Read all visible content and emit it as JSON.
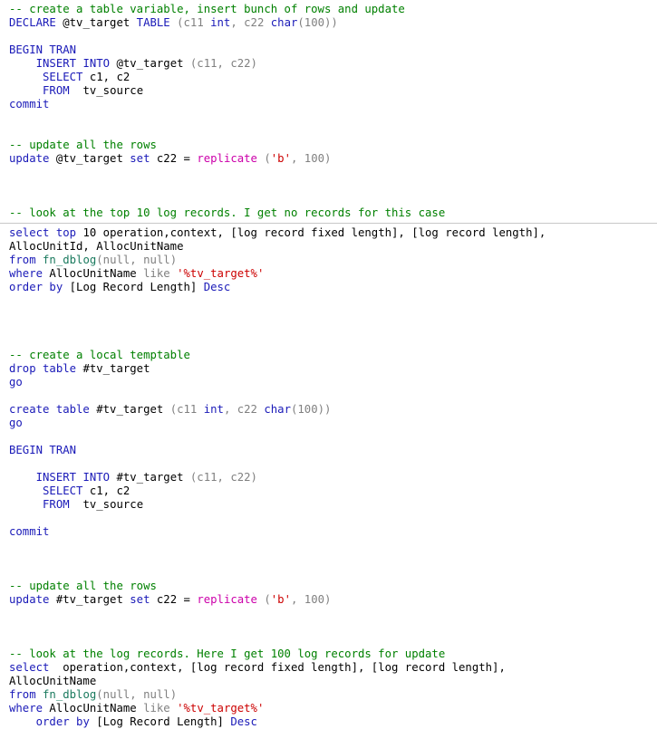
{
  "document": {
    "kind": "sql-code-listing",
    "language": "T-SQL",
    "colors": {
      "background": "#ffffff",
      "comment": "#008000",
      "keyword": "#1a1ab8",
      "string": "#cc0000",
      "function": "#cc00aa",
      "system_function": "#1a7a5e",
      "literal": "#808080",
      "plain_text": "#000000",
      "divider": "#c8c8c8"
    }
  },
  "blocks": [
    {
      "id": "block-1",
      "lines": [
        {
          "indent": 0,
          "tokens": [
            {
              "t": "comment",
              "v": "-- create a table variable, insert bunch of rows and update"
            }
          ]
        },
        {
          "indent": 0,
          "tokens": [
            {
              "t": "keyword",
              "v": "DECLARE"
            },
            {
              "t": "plain",
              "v": " @tv_target "
            },
            {
              "t": "keyword",
              "v": "TABLE"
            },
            {
              "t": "lit",
              "v": " (c11 "
            },
            {
              "t": "keyword",
              "v": "int"
            },
            {
              "t": "lit",
              "v": ", c22 "
            },
            {
              "t": "keyword",
              "v": "char"
            },
            {
              "t": "lit",
              "v": "(100))"
            }
          ]
        },
        {
          "indent": 0,
          "tokens": []
        },
        {
          "indent": 0,
          "tokens": [
            {
              "t": "keyword",
              "v": "BEGIN TRAN"
            }
          ]
        },
        {
          "indent": 0,
          "tokens": [
            {
              "t": "plain",
              "v": "    "
            },
            {
              "t": "keyword",
              "v": "INSERT INTO"
            },
            {
              "t": "plain",
              "v": " @tv_target "
            },
            {
              "t": "lit",
              "v": "(c11, c22)"
            }
          ]
        },
        {
          "indent": 0,
          "tokens": [
            {
              "t": "plain",
              "v": "     "
            },
            {
              "t": "keyword",
              "v": "SELECT"
            },
            {
              "t": "plain",
              "v": " c1, c2"
            }
          ]
        },
        {
          "indent": 0,
          "tokens": [
            {
              "t": "plain",
              "v": "     "
            },
            {
              "t": "keyword",
              "v": "FROM"
            },
            {
              "t": "plain",
              "v": "  tv_source"
            }
          ]
        },
        {
          "indent": 0,
          "tokens": [
            {
              "t": "keyword",
              "v": "commit"
            }
          ]
        },
        {
          "indent": 0,
          "tokens": []
        },
        {
          "indent": 0,
          "tokens": []
        },
        {
          "indent": 0,
          "tokens": [
            {
              "t": "comment",
              "v": "-- update all the rows"
            }
          ]
        },
        {
          "indent": 0,
          "tokens": [
            {
              "t": "keyword",
              "v": "update"
            },
            {
              "t": "plain",
              "v": " @tv_target "
            },
            {
              "t": "keyword",
              "v": "set"
            },
            {
              "t": "plain",
              "v": " c22 "
            },
            {
              "t": "plain",
              "v": "= "
            },
            {
              "t": "func",
              "v": "replicate"
            },
            {
              "t": "lit",
              "v": " ("
            },
            {
              "t": "string",
              "v": "'b'"
            },
            {
              "t": "lit",
              "v": ", 100)"
            }
          ]
        },
        {
          "indent": 0,
          "tokens": []
        },
        {
          "indent": 0,
          "tokens": []
        },
        {
          "indent": 0,
          "tokens": []
        },
        {
          "indent": 0,
          "tokens": [
            {
              "t": "comment",
              "v": "-- look at the top 10 log records. I get no records for this case"
            }
          ]
        }
      ]
    },
    {
      "id": "block-2",
      "divider_before": true,
      "lines": [
        {
          "indent": 0,
          "tokens": [
            {
              "t": "keyword",
              "v": "select top"
            },
            {
              "t": "plain",
              "v": " 10 operation,context, [log record fixed length], [log record length],"
            }
          ]
        },
        {
          "indent": 0,
          "tokens": [
            {
              "t": "plain",
              "v": "AllocUnitId, AllocUnitName"
            }
          ]
        },
        {
          "indent": 0,
          "tokens": [
            {
              "t": "keyword",
              "v": "from"
            },
            {
              "t": "plain",
              "v": " "
            },
            {
              "t": "sysfunc",
              "v": "fn_dblog"
            },
            {
              "t": "lit",
              "v": "(null, null)"
            }
          ]
        },
        {
          "indent": 0,
          "tokens": [
            {
              "t": "keyword",
              "v": "where"
            },
            {
              "t": "plain",
              "v": " AllocUnitName "
            },
            {
              "t": "lit",
              "v": "like"
            },
            {
              "t": "plain",
              "v": " "
            },
            {
              "t": "string",
              "v": "'%tv_target%'"
            }
          ]
        },
        {
          "indent": 0,
          "tokens": [
            {
              "t": "keyword",
              "v": "order by"
            },
            {
              "t": "plain",
              "v": " [Log Record Length] "
            },
            {
              "t": "keyword",
              "v": "Desc"
            }
          ]
        },
        {
          "indent": 0,
          "tokens": []
        },
        {
          "indent": 0,
          "tokens": []
        },
        {
          "indent": 0,
          "tokens": []
        },
        {
          "indent": 0,
          "tokens": []
        },
        {
          "indent": 0,
          "tokens": [
            {
              "t": "comment",
              "v": "-- create a local temptable"
            }
          ]
        },
        {
          "indent": 0,
          "tokens": [
            {
              "t": "keyword",
              "v": "drop table"
            },
            {
              "t": "plain",
              "v": " #tv_target"
            }
          ]
        },
        {
          "indent": 0,
          "tokens": [
            {
              "t": "keyword",
              "v": "go"
            }
          ]
        },
        {
          "indent": 0,
          "tokens": []
        },
        {
          "indent": 0,
          "tokens": [
            {
              "t": "keyword",
              "v": "create table"
            },
            {
              "t": "plain",
              "v": " #tv_target "
            },
            {
              "t": "lit",
              "v": "(c11 "
            },
            {
              "t": "keyword",
              "v": "int"
            },
            {
              "t": "lit",
              "v": ", c22 "
            },
            {
              "t": "keyword",
              "v": "char"
            },
            {
              "t": "lit",
              "v": "(100))"
            }
          ]
        },
        {
          "indent": 0,
          "tokens": [
            {
              "t": "keyword",
              "v": "go"
            }
          ]
        },
        {
          "indent": 0,
          "tokens": []
        },
        {
          "indent": 0,
          "tokens": [
            {
              "t": "keyword",
              "v": "BEGIN TRAN"
            }
          ]
        },
        {
          "indent": 0,
          "tokens": []
        },
        {
          "indent": 0,
          "tokens": [
            {
              "t": "plain",
              "v": "    "
            },
            {
              "t": "keyword",
              "v": "INSERT INTO"
            },
            {
              "t": "plain",
              "v": " #tv_target "
            },
            {
              "t": "lit",
              "v": "(c11, c22)"
            }
          ]
        },
        {
          "indent": 0,
          "tokens": [
            {
              "t": "plain",
              "v": "     "
            },
            {
              "t": "keyword",
              "v": "SELECT"
            },
            {
              "t": "plain",
              "v": " c1, c2"
            }
          ]
        },
        {
          "indent": 0,
          "tokens": [
            {
              "t": "plain",
              "v": "     "
            },
            {
              "t": "keyword",
              "v": "FROM"
            },
            {
              "t": "plain",
              "v": "  tv_source"
            }
          ]
        },
        {
          "indent": 0,
          "tokens": []
        },
        {
          "indent": 0,
          "tokens": [
            {
              "t": "keyword",
              "v": "commit"
            }
          ]
        },
        {
          "indent": 0,
          "tokens": []
        },
        {
          "indent": 0,
          "tokens": []
        },
        {
          "indent": 0,
          "tokens": []
        },
        {
          "indent": 0,
          "tokens": [
            {
              "t": "comment",
              "v": "-- update all the rows"
            }
          ]
        },
        {
          "indent": 0,
          "tokens": [
            {
              "t": "keyword",
              "v": "update"
            },
            {
              "t": "plain",
              "v": " #tv_target "
            },
            {
              "t": "keyword",
              "v": "set"
            },
            {
              "t": "plain",
              "v": " c22 "
            },
            {
              "t": "plain",
              "v": "= "
            },
            {
              "t": "func",
              "v": "replicate"
            },
            {
              "t": "lit",
              "v": " ("
            },
            {
              "t": "string",
              "v": "'b'"
            },
            {
              "t": "lit",
              "v": ", 100)"
            }
          ]
        },
        {
          "indent": 0,
          "tokens": []
        },
        {
          "indent": 0,
          "tokens": []
        },
        {
          "indent": 0,
          "tokens": []
        },
        {
          "indent": 0,
          "tokens": [
            {
              "t": "comment",
              "v": "-- look at the log records. Here I get 100 log records for update"
            }
          ]
        },
        {
          "indent": 0,
          "tokens": [
            {
              "t": "keyword",
              "v": "select"
            },
            {
              "t": "plain",
              "v": "  operation,context, [log record fixed length], [log record length],"
            }
          ]
        },
        {
          "indent": 0,
          "tokens": [
            {
              "t": "plain",
              "v": "AllocUnitName"
            }
          ]
        },
        {
          "indent": 0,
          "tokens": [
            {
              "t": "keyword",
              "v": "from"
            },
            {
              "t": "plain",
              "v": " "
            },
            {
              "t": "sysfunc",
              "v": "fn_dblog"
            },
            {
              "t": "lit",
              "v": "(null, null)"
            }
          ]
        },
        {
          "indent": 0,
          "tokens": [
            {
              "t": "keyword",
              "v": "where"
            },
            {
              "t": "plain",
              "v": " AllocUnitName "
            },
            {
              "t": "lit",
              "v": "like"
            },
            {
              "t": "plain",
              "v": " "
            },
            {
              "t": "string",
              "v": "'%tv_target%'"
            }
          ]
        },
        {
          "indent": 0,
          "tokens": [
            {
              "t": "plain",
              "v": "    "
            },
            {
              "t": "keyword",
              "v": "order by"
            },
            {
              "t": "plain",
              "v": " [Log Record Length] "
            },
            {
              "t": "keyword",
              "v": "Desc"
            }
          ]
        }
      ]
    }
  ]
}
